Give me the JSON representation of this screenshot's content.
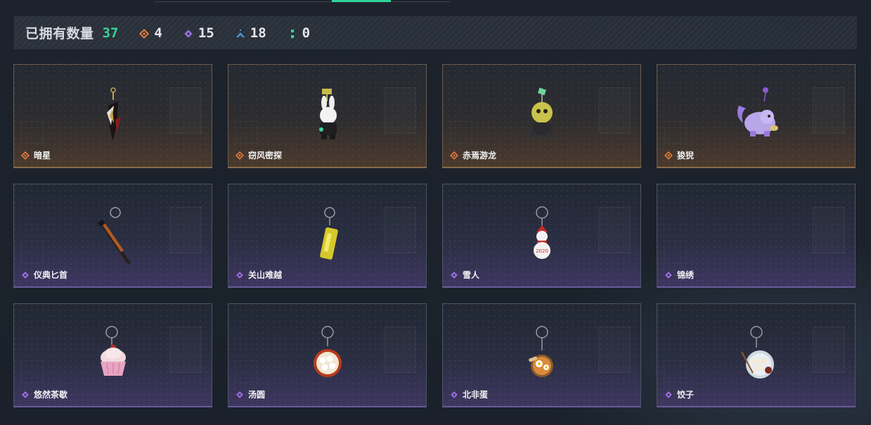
{
  "summary": {
    "label": "已拥有数量",
    "total": "37",
    "stats": [
      {
        "icon": "orange-diamond-icon",
        "color": "#e07a3c",
        "value": "4"
      },
      {
        "icon": "purple-diamond-icon",
        "color": "#9b6ee0",
        "value": "15"
      },
      {
        "icon": "blue-chevron-icon",
        "color": "#4a9be0",
        "value": "18"
      },
      {
        "icon": "green-dots-icon",
        "color": "#3bd49a",
        "value": "0"
      }
    ]
  },
  "colors": {
    "accent": "#37d494",
    "gold_rarity": "#e07a3c",
    "purple_rarity": "#9b6ee0"
  },
  "cards": [
    {
      "name": "暗星",
      "rarity": "gold",
      "art": "dark-star-charm"
    },
    {
      "name": "窃风密探",
      "rarity": "gold",
      "art": "bunny-spy-charm"
    },
    {
      "name": "赤焉游龙",
      "rarity": "gold",
      "art": "yellow-lion-charm"
    },
    {
      "name": "狻猊",
      "rarity": "gold",
      "art": "purple-beast-charm"
    },
    {
      "name": "仪典匕首",
      "rarity": "purple",
      "art": "dagger-charm"
    },
    {
      "name": "关山难越",
      "rarity": "purple",
      "art": "yellow-can-charm"
    },
    {
      "name": "雪人",
      "rarity": "purple",
      "art": "snowman-charm"
    },
    {
      "name": "锦绣",
      "rarity": "purple",
      "art": "empty-charm"
    },
    {
      "name": "悠然茶歇",
      "rarity": "purple",
      "art": "cupcake-charm"
    },
    {
      "name": "汤圆",
      "rarity": "purple",
      "art": "tangyuan-charm"
    },
    {
      "name": "北非蛋",
      "rarity": "purple",
      "art": "shakshuka-charm"
    },
    {
      "name": "饺子",
      "rarity": "purple",
      "art": "dumpling-plate-charm"
    }
  ]
}
